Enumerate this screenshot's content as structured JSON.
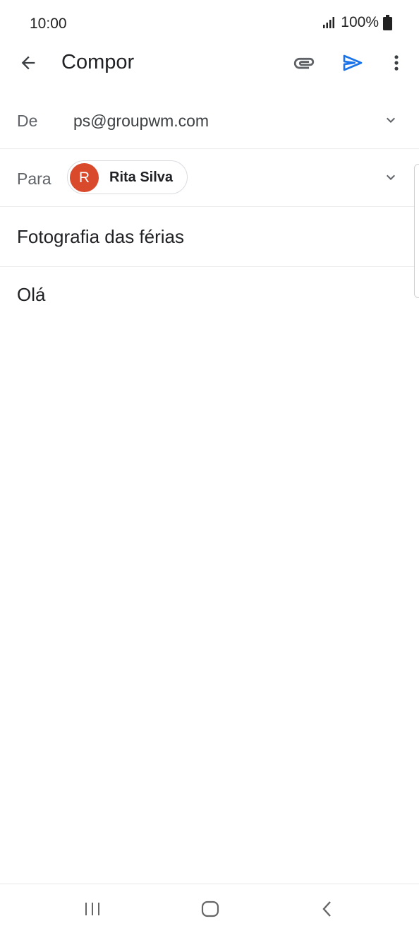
{
  "status_bar": {
    "time": "10:00",
    "battery_text": "100%",
    "signal_icon": "signal-icon",
    "battery_icon": "battery-icon"
  },
  "app_bar": {
    "title": "Compor",
    "back_icon": "arrow-back-icon",
    "attach_icon": "paperclip-icon",
    "send_icon": "send-icon",
    "more_icon": "more-vert-icon",
    "accent_color": "#1a73e8"
  },
  "from": {
    "label": "De",
    "value": "ps@groupwm.com"
  },
  "to": {
    "label": "Para",
    "recipient_initial": "R",
    "recipient_name": "Rita Silva",
    "avatar_color": "#d94a2d"
  },
  "subject": "Fotografia das férias",
  "body": "Olá",
  "nav_bar": {
    "recents_icon": "recents-icon",
    "home_icon": "home-icon",
    "back_icon": "nav-back-icon"
  }
}
